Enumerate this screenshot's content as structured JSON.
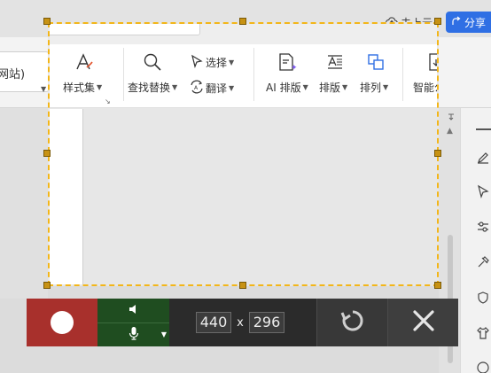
{
  "app": {
    "cloud_status": "未上云",
    "share_label": "分享",
    "font_name_fragment": "网站)"
  },
  "ribbon": {
    "style_set_label": "样式集",
    "find_replace_label": "查找替换",
    "select_label": "选择",
    "translate_label": "翻译",
    "ai_layout_label": "AI 排版",
    "layout_label": "排版",
    "arrange_label": "排列",
    "smart_doc_label": "智能公文"
  },
  "recorder": {
    "width_value": "440",
    "height_value": "296",
    "times_sign": "x",
    "accent_record": "#a8302c",
    "accent_audio": "#1f4d20",
    "selection_border": "#f3b619"
  },
  "icons": {
    "record": "record-dot-icon",
    "speaker": "speaker-icon",
    "microphone": "microphone-icon",
    "reset": "rotate-reset-icon",
    "close": "close-x-icon"
  }
}
